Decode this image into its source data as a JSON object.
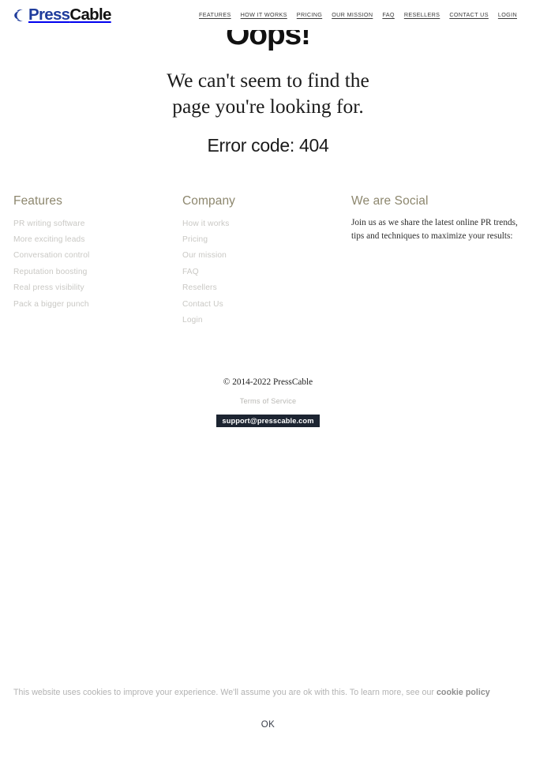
{
  "header": {
    "logo": {
      "icon": "crescent-moon-icon",
      "part1": "Press",
      "part2": "Cable",
      "color_part1": "#1f3c9c",
      "color_part2": "#111111"
    },
    "nav": [
      {
        "label": "FEATURES"
      },
      {
        "label": "HOW IT WORKS"
      },
      {
        "label": "PRICING"
      },
      {
        "label": "OUR MISSION"
      },
      {
        "label": "FAQ"
      },
      {
        "label": "RESELLERS"
      },
      {
        "label": "CONTACT US"
      },
      {
        "label": "LOGIN"
      }
    ]
  },
  "hero": {
    "heading": "Oops!",
    "message_line1": "We can't seem to find the",
    "message_line2": "page you're looking for.",
    "error_code": "Error code: 404"
  },
  "footer": {
    "features": {
      "title": "Features",
      "items": [
        {
          "label": "PR writing software"
        },
        {
          "label": "More exciting leads"
        },
        {
          "label": "Conversation control"
        },
        {
          "label": "Reputation boosting"
        },
        {
          "label": "Real press visibility"
        },
        {
          "label": "Pack a bigger punch"
        }
      ]
    },
    "company": {
      "title": "Company",
      "items": [
        {
          "label": "How it works"
        },
        {
          "label": "Pricing"
        },
        {
          "label": "Our mission"
        },
        {
          "label": "FAQ"
        },
        {
          "label": "Resellers"
        },
        {
          "label": "Contact Us"
        },
        {
          "label": "Login"
        }
      ]
    },
    "social": {
      "title": "We are Social",
      "body": "Join us as we share the latest online PR trends, tips and techniques to maximize your results:"
    },
    "copyright": "© 2014-2022 PressCable",
    "terms_label": "Terms of Service",
    "email": "support@presscable.com",
    "email_badge_bg": "#1c2431"
  },
  "cookie_banner": {
    "text": "This website uses cookies to improve your experience. We'll assume you are ok with this. To learn more, see our ",
    "link_label": "cookie policy",
    "ok_label": "OK"
  },
  "colors": {
    "heading_olive": "#8d876e",
    "muted_link": "#c9c8c4",
    "cookie_text": "#b2b2b2"
  }
}
